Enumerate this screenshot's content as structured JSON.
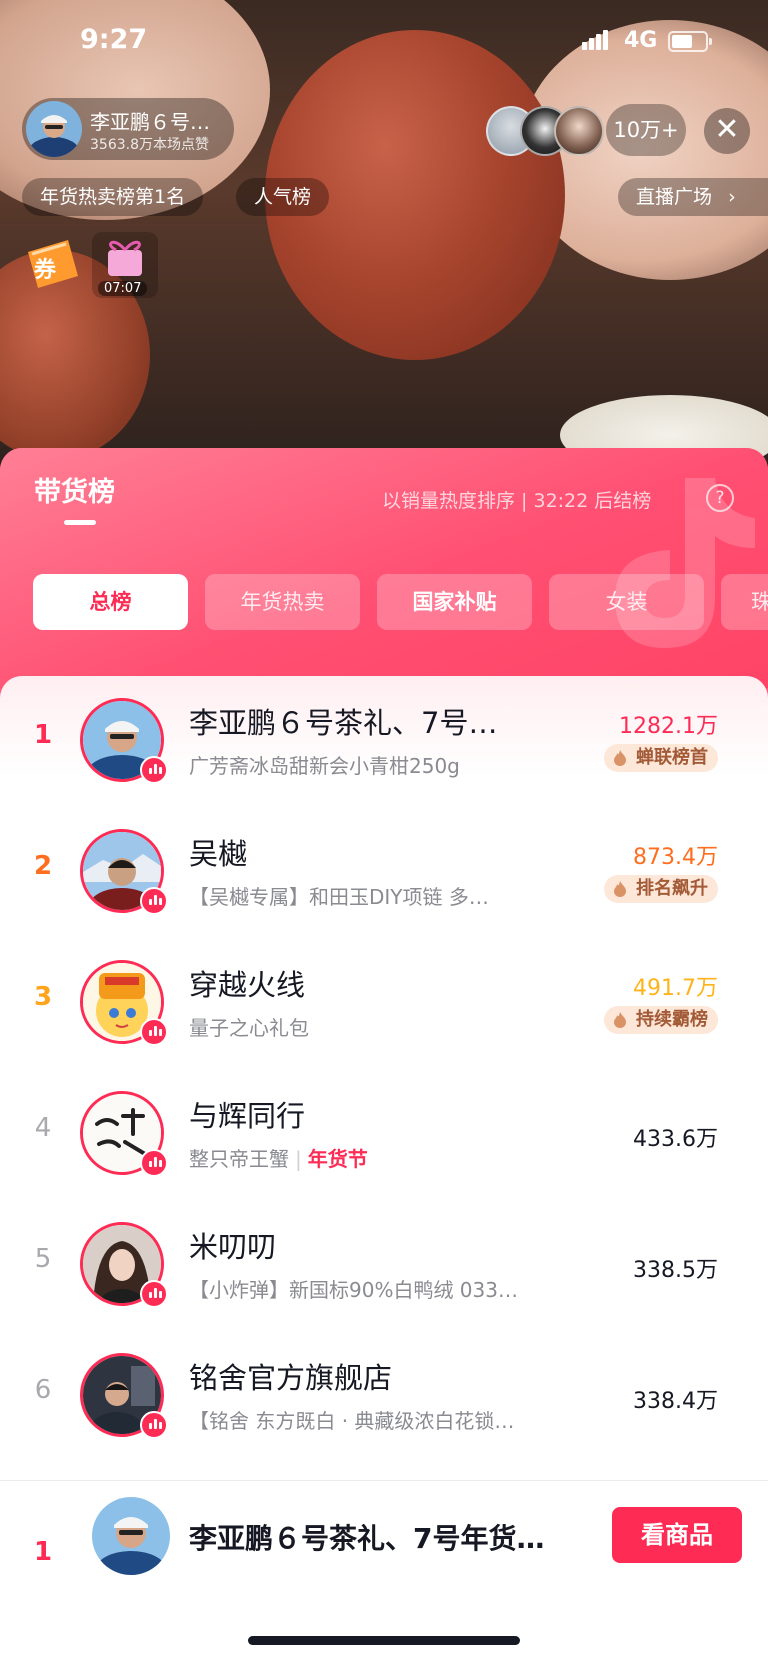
{
  "status_bar": {
    "time": "9:27",
    "network": "4G"
  },
  "host": {
    "name": "李亚鹏６号…",
    "likes": "3563.8万本场点赞"
  },
  "viewer_count": "10万+",
  "top_chips": {
    "rank_chip": "年货热卖榜第1名",
    "popular_chip": "人气榜",
    "plaza_chip": "直播广场"
  },
  "coupon_label": "券",
  "gift_timer": "07:07",
  "board": {
    "title": "带货榜",
    "sort_note": "以销量热度排序 | 32:22 后结榜",
    "help_symbol": "?",
    "tabs": [
      "总榜",
      "年货热卖",
      "国家补贴",
      "女装",
      "珠"
    ],
    "rows": [
      {
        "rank": "1",
        "title": "李亚鹏６号茶礼、7号…",
        "subtitle": "广芳斋冰岛甜新会小青柑250g",
        "amount": "1282.1万",
        "badge": "蝉联榜首"
      },
      {
        "rank": "2",
        "title": "吴樾",
        "subtitle": "【吴樾专属】和田玉DIY项链 多…",
        "amount": "873.4万",
        "badge": "排名飙升"
      },
      {
        "rank": "3",
        "title": "穿越火线",
        "subtitle": "量子之心礼包",
        "amount": "491.7万",
        "badge": "持续霸榜"
      },
      {
        "rank": "4",
        "title": "与辉同行",
        "subtitle": "整只帝王蟹",
        "tag": "年货节",
        "amount": "433.6万"
      },
      {
        "rank": "5",
        "title": "米叨叨",
        "subtitle": "【小炸弹】新国标90%白鸭绒 033…",
        "amount": "338.5万"
      },
      {
        "rank": "6",
        "title": "铭舍官方旗舰店",
        "subtitle": "【铭舍 东方既白 · 典藏级浓白花锁…",
        "amount": "338.4万"
      }
    ]
  },
  "bottom_bar": {
    "rank": "1",
    "title": "李亚鹏６号茶礼、7号年货…",
    "button": "看商品"
  },
  "colors": {
    "accent": "#fe2c55",
    "rank2": "#ff6d1f",
    "rank3": "#ffa41b"
  },
  "icons": {
    "close": "close-icon",
    "chevron": "chevron-right-icon",
    "help": "help-icon",
    "live": "live-bars-icon",
    "flame": "flame-icon"
  }
}
